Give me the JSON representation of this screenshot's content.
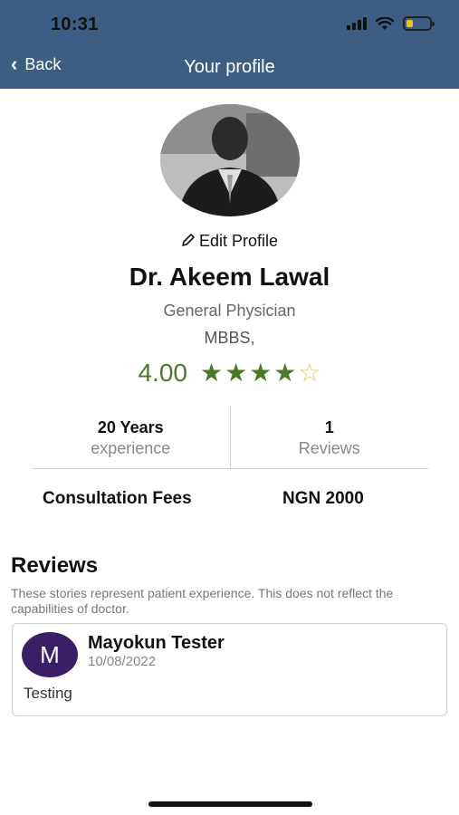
{
  "status_bar": {
    "time": "10:31"
  },
  "header": {
    "back_label": "Back",
    "title": "Your profile"
  },
  "profile": {
    "edit_label": "Edit Profile",
    "name": "Dr. Akeem Lawal",
    "specialty": "General Physician",
    "qualification": "MBBS,",
    "rating": "4.00",
    "stars_filled": 4,
    "stars_total": 5
  },
  "stats": {
    "experience_value": "20 Years",
    "experience_label": "experience",
    "reviews_value": "1",
    "reviews_label": "Reviews"
  },
  "fees": {
    "label": "Consultation Fees",
    "value": "NGN 2000"
  },
  "reviews": {
    "heading": "Reviews",
    "note": "These stories represent patient experience. This does not reflect the capabilities of doctor.",
    "items": [
      {
        "initial": "M",
        "name": "Mayokun Tester",
        "date": "10/08/2022",
        "text": "Testing"
      }
    ]
  },
  "colors": {
    "header": "#3d5e82",
    "rating": "#4a7a28",
    "review_avatar": "#3a1f66"
  },
  "icons": [
    "chevron-left-icon",
    "pencil-icon",
    "star-icon",
    "signal-icon",
    "wifi-icon",
    "battery-icon"
  ]
}
